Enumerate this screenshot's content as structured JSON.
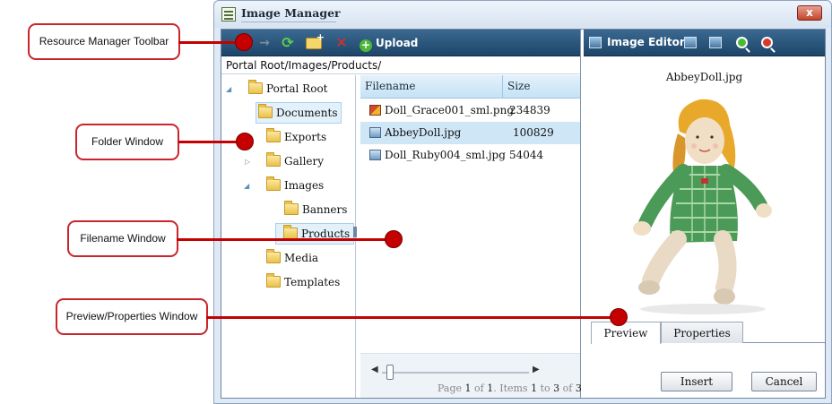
{
  "window": {
    "title": "Image Manager",
    "close_label": "x"
  },
  "toolbar": {
    "upload_label": "Upload"
  },
  "path": "Portal Root/Images/Products/",
  "folders": [
    {
      "label": "Portal Root"
    },
    {
      "label": "Documents"
    },
    {
      "label": "Exports"
    },
    {
      "label": "Gallery"
    },
    {
      "label": "Images"
    },
    {
      "label": "Banners"
    },
    {
      "label": "Products"
    },
    {
      "label": "Media"
    },
    {
      "label": "Templates"
    }
  ],
  "files": {
    "headers": {
      "filename": "Filename",
      "size": "Size"
    },
    "rows": [
      {
        "name": "Doll_Grace001_sml.png",
        "size": "234839"
      },
      {
        "name": "AbbeyDoll.jpg",
        "size": "100829"
      },
      {
        "name": "Doll_Ruby004_sml.jpg",
        "size": "54044"
      }
    ],
    "selected": "AbbeyDoll.jpg"
  },
  "pager": {
    "page_word": "Page",
    "page": "1",
    "of_word": "of",
    "pages": "1",
    "items_word": ". Items",
    "from": "1",
    "to_word": "to",
    "to": "3",
    "of2": "of",
    "total": "3"
  },
  "editor": {
    "title": "Image Editor"
  },
  "preview": {
    "filename": "AbbeyDoll.jpg"
  },
  "tabs": [
    {
      "label": "Preview"
    },
    {
      "label": "Properties"
    }
  ],
  "buttons": {
    "insert": "Insert",
    "cancel": "Cancel"
  },
  "callouts": [
    {
      "label": "Resource Manager Toolbar"
    },
    {
      "label": "Folder Window"
    },
    {
      "label": "Filename Window"
    },
    {
      "label": "Preview/Properties Window"
    }
  ],
  "colors": {
    "annotation_red": "#c40000",
    "toolbar_blue": "#1e4569",
    "selection_blue": "#cfe6f7"
  }
}
